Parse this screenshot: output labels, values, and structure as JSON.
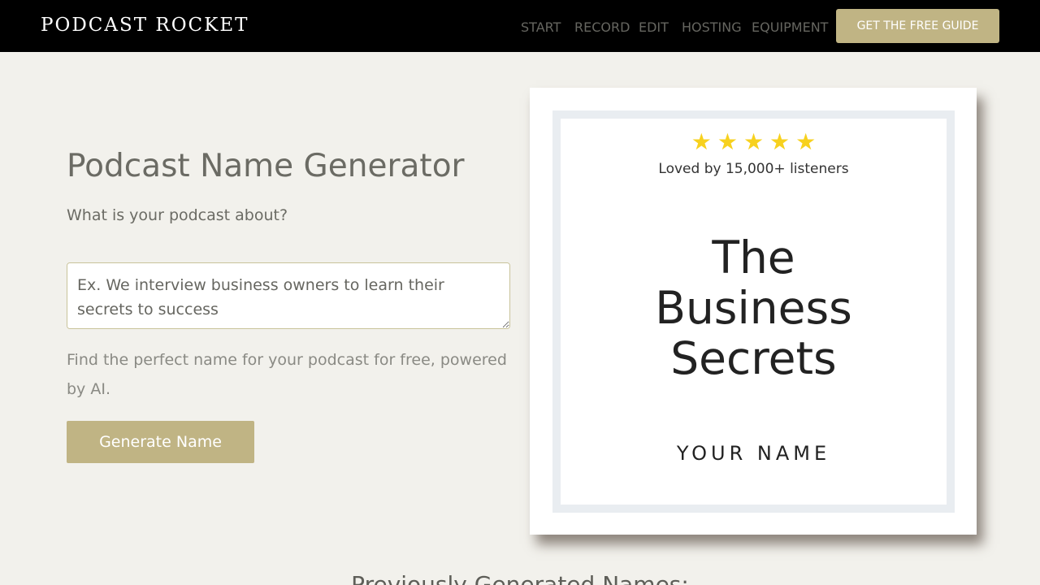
{
  "header": {
    "logo": "PODCAST ROCKET",
    "nav": [
      {
        "label": "START"
      },
      {
        "label": "RECORD"
      },
      {
        "label": "EDIT"
      },
      {
        "label": "HOSTING"
      },
      {
        "label": "EQUIPMENT"
      }
    ],
    "cta_label": "GET THE FREE GUIDE"
  },
  "generator": {
    "title": "Podcast Name Generator",
    "question": "What is your podcast about?",
    "input_placeholder": "Ex. We interview business owners to learn their secrets to success",
    "input_value": "",
    "tagline": "Find the perfect name for your podcast for free, powered by AI.",
    "button_label": "Generate Name"
  },
  "cover": {
    "stars": [
      "★",
      "★",
      "★",
      "★",
      "★"
    ],
    "rating": 5,
    "loved_text": "Loved by 15,000+ listeners",
    "title_lines": [
      "The",
      "Business",
      "Secrets"
    ],
    "author": "YOUR NAME"
  },
  "history": {
    "heading": "Previously Generated Names:"
  },
  "colors": {
    "page_background": "#f2f1ec",
    "header_background": "#000000",
    "accent": "#c0b484",
    "star": "#f7d11e",
    "cover_border": "#e9edf1"
  }
}
